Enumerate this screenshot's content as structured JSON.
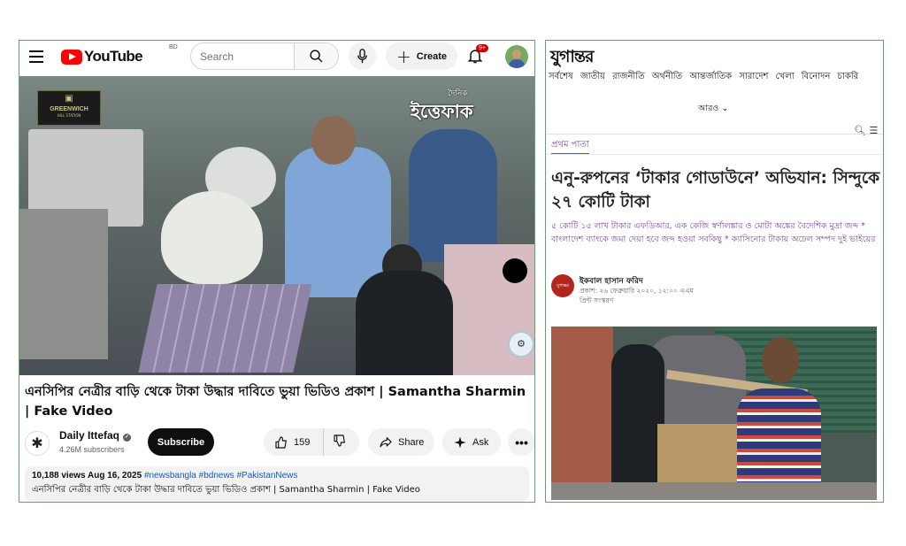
{
  "youtube": {
    "logo_text": "YouTube",
    "country_code": "BD",
    "search_placeholder": "Search",
    "create_label": "Create",
    "notification_count": "9+",
    "video": {
      "overlay_left": {
        "mark": "▣",
        "title": "GREENWICH",
        "subtitle": "HILL STATION"
      },
      "overlay_right": {
        "small": "দৈনিক",
        "big": "ইত্তেফাক"
      }
    },
    "title": "এনসিপির নেত্রীর বাড়ি থেকে টাকা উদ্ধার দাবিতে ভুয়া ভিডিও প্রকাশ | Samantha Sharmin | Fake Video",
    "channel": {
      "name": "Daily Ittefaq",
      "subscribers": "4.26M subscribers",
      "subscribe_label": "Subscribe"
    },
    "actions": {
      "likes": "159",
      "share_label": "Share",
      "ask_label": "Ask",
      "more_label": "•••"
    },
    "description": {
      "views_date": "10,188 views  Aug 16, 2025",
      "hashtags": "#newsbangla #bdnews #PakistanNews",
      "text": "এনসিপির নেত্রীর বাড়ি থেকে টাকা উদ্ধার দাবিতে ভুয়া ভিডিও প্রকাশ | Samantha Sharmin | Fake Video"
    }
  },
  "jugantor": {
    "logo": "যুগান্তর",
    "nav": [
      "সর্বশেষ",
      "জাতীয়",
      "রাজনীতি",
      "অর্থনীতি",
      "আন্তর্জাতিক",
      "সারাদেশ",
      "খেলা",
      "বিনোদন",
      "চাকরি"
    ],
    "more_label": "আরও",
    "breadcrumb": "প্রথম পাতা",
    "headline": "এনু-রুপনের ‘টাকার গোডাউনে’ অভিযান: সিন্দুকে ২৭ কোটি টাকা",
    "subheadline": "৫ কোটি ১৫ লাখ টাকার এফডিআর, এক কেজি স্বর্ণালঙ্কার ও মোটা অঙ্কের বৈদেশিক মুদ্রা জব্দ * বাংলাদেশ ব্যাংকে জমা দেয়া হবে জব্দ হওয়া সবকিছু * ক্যাসিনোর টাকায় অঢেল সম্পদ দুই ভাইয়ের",
    "author_logo_text": "যুগান্তর",
    "author": "ইকবাল হাসান ফরিদ",
    "published": "প্রকাশ: ২৬ ফেব্রুয়ারি ২০২০, ১২:০০ এএম",
    "print_edition": "প্রিন্ট সংস্করণ"
  }
}
